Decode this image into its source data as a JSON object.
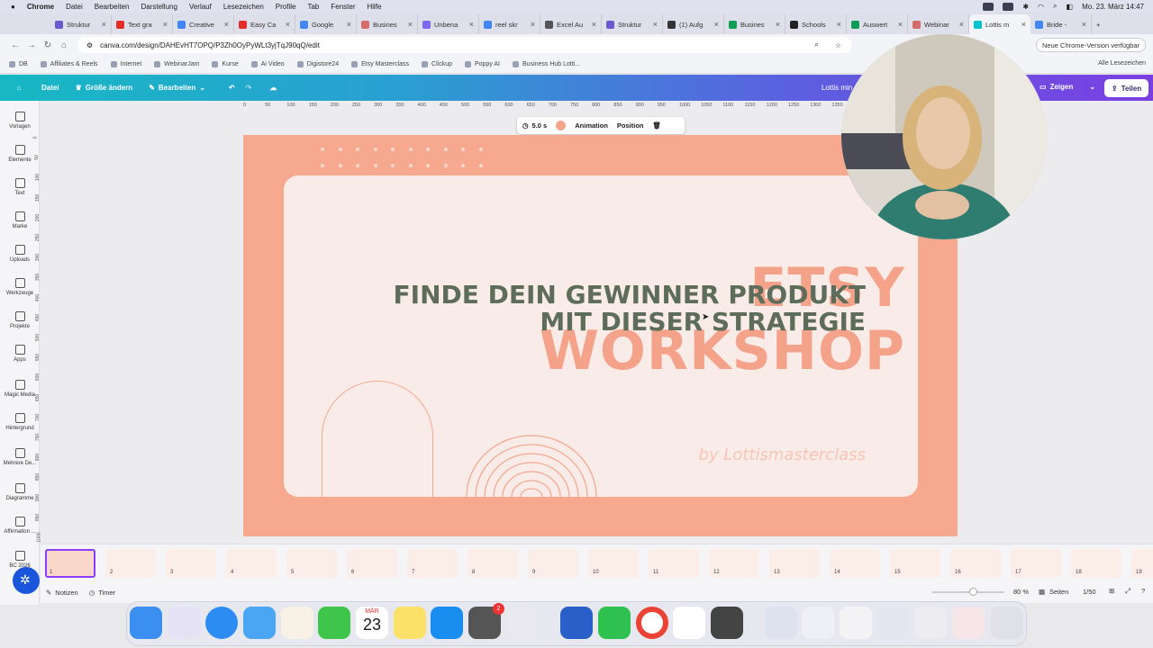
{
  "menubar": {
    "apple": "",
    "app": "Chrome",
    "items": [
      "Datei",
      "Bearbeiten",
      "Darstellung",
      "Verlauf",
      "Lesezeichen",
      "Profile",
      "Tab",
      "Fenster",
      "Hilfe"
    ],
    "clock": "Mo. 23. März  14:47"
  },
  "tabs": [
    {
      "label": "Struktur",
      "color": "#6a5acd"
    },
    {
      "label": "Text gra",
      "color": "#e52d27"
    },
    {
      "label": "Creative",
      "color": "#4285f4"
    },
    {
      "label": "Easy Ca",
      "color": "#e52d27"
    },
    {
      "label": "Google",
      "color": "#4285f4"
    },
    {
      "label": "Busines",
      "color": "#d86b6b"
    },
    {
      "label": "Unbena",
      "color": "#7b68ee"
    },
    {
      "label": "reel skr",
      "color": "#4285f4"
    },
    {
      "label": "Excel Au",
      "color": "#555"
    },
    {
      "label": "Struktur",
      "color": "#6a5acd"
    },
    {
      "label": "(1) Aufg",
      "color": "#333"
    },
    {
      "label": "Busines",
      "color": "#0f9d58"
    },
    {
      "label": "Schools",
      "color": "#222"
    },
    {
      "label": "Auswert",
      "color": "#0f9d58"
    },
    {
      "label": "Webinar",
      "color": "#d86b6b"
    },
    {
      "label": "Lottis m",
      "color": "#00c4cc"
    },
    {
      "label": "Bride -",
      "color": "#4285f4"
    }
  ],
  "address": {
    "url": "canva.com/design/DAHEvHT7OPQ/P3Zh0OyPyWLt3yjTqJ90qQ/edit",
    "update": "Neue Chrome-Version verfügbar"
  },
  "bookmarks": [
    "DB",
    "Affiliates & Reels",
    "Internet",
    "WebinarJam",
    "Kurse",
    "Ai Video",
    "Digistore24",
    "Etsy Masterclass",
    "Clickup",
    "Poppy AI",
    "Business Hub Lotti..."
  ],
  "all_bookmarks": "Alle Lesezeichen",
  "canva": {
    "datei": "Datei",
    "resize": "Größe ändern",
    "edit": "Bearbeiten",
    "doc_title": "Lottis min",
    "zeigen": "Zeigen",
    "teilen": "Teilen"
  },
  "sidebar": [
    "Vorlagen",
    "Elemente",
    "Text",
    "Marke",
    "Uploads",
    "Werkzeuge",
    "Projekte",
    "Apps",
    "Magic Media",
    "Hintergrund",
    "Mehrere De...",
    "Diagramme",
    "Affirmation ...",
    "BC 2026"
  ],
  "ruler": [
    "0",
    "50",
    "100",
    "150",
    "200",
    "250",
    "300",
    "350",
    "400",
    "450",
    "500",
    "550",
    "600",
    "650",
    "700",
    "750",
    "800",
    "850",
    "900",
    "950",
    "1000",
    "1050",
    "1100",
    "1150",
    "1200",
    "1250",
    "1300",
    "1350",
    "1400",
    "1450",
    "1500",
    "1550",
    "160"
  ],
  "vruler": [
    "0",
    "50",
    "100",
    "150",
    "200",
    "250",
    "300",
    "350",
    "400",
    "450",
    "500",
    "550",
    "600",
    "650",
    "700",
    "750",
    "800",
    "850",
    "900",
    "950",
    "1000"
  ],
  "toolbar": {
    "duration": "5.0 s",
    "animation": "Animation",
    "position": "Position",
    "slide_color": "#f4a58b"
  },
  "slide": {
    "title": "ETSY WORKSHOP",
    "sub1": "FINDE DEIN GEWINNER PRODUKT",
    "sub2": "MIT DIESER STRATEGIE",
    "byline": "by Lottismasterclass"
  },
  "thumbs": [
    "1",
    "2",
    "3",
    "4",
    "5",
    "6",
    "7",
    "8",
    "9",
    "10",
    "11",
    "12",
    "13",
    "14",
    "15",
    "16",
    "17",
    "18",
    "19"
  ],
  "status": {
    "notes": "Notizen",
    "timer": "Timer",
    "zoom": "80 %",
    "pages_label": "Seiten",
    "pages": "1/50"
  },
  "dock": {
    "calendar_month": "MÄR",
    "calendar_day": "23",
    "settings_badge": "2"
  }
}
